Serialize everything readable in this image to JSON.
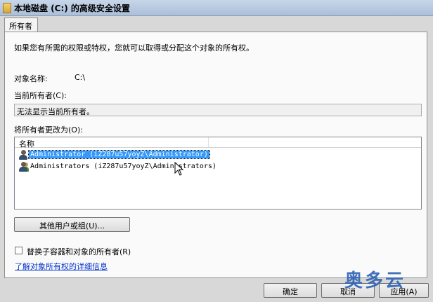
{
  "window": {
    "title": "本地磁盘 (C:) 的高级安全设置"
  },
  "tabs": [
    {
      "label": "所有者"
    }
  ],
  "owner": {
    "intro": "如果您有所需的权限或特权，您就可以取得或分配这个对象的所有权。",
    "object_name_label": "对象名称:",
    "object_name_value": "C:\\",
    "current_owner_label": "当前所有者(C):",
    "current_owner_value": "无法显示当前所有者。",
    "change_owner_label": "将所有者更改为(O):",
    "list_header": "名称",
    "list_items": [
      {
        "label": "Administrator (iZ287u57yoyZ\\Administrator)",
        "selected": true,
        "icon": "user-icon"
      },
      {
        "label": "Administrators (iZ287u57yoyZ\\Administrators)",
        "selected": false,
        "icon": "group-icon"
      }
    ],
    "other_users_button": "其他用户或组(U)...",
    "replace_checkbox_label": "替换子容器和对象的所有者(R)",
    "replace_checked": false,
    "learn_more_link": "了解对象所有权的详细信息"
  },
  "footer": {
    "ok": "确定",
    "cancel": "取消",
    "apply": "应用(A)"
  },
  "watermark": "奥多云"
}
